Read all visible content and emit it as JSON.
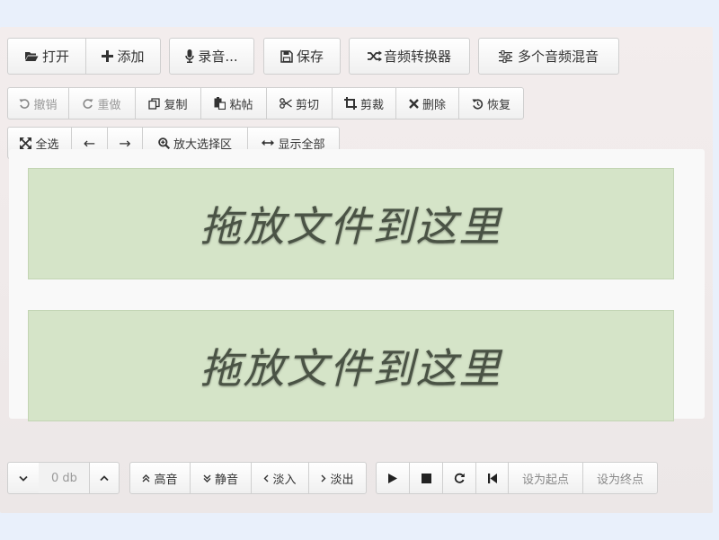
{
  "toolbar": {
    "open": "打开",
    "add": "添加",
    "record": "录音...",
    "save": "保存",
    "converter": "音频转换器",
    "mixer": "多个音频混音"
  },
  "edit": {
    "undo": "撤销",
    "redo": "重做",
    "copy": "复制",
    "paste": "粘帖",
    "cut": "剪切",
    "crop": "剪裁",
    "delete": "删除",
    "restore": "恢复"
  },
  "selection": {
    "select_all": "全选",
    "left_arrow": "←",
    "right_arrow": "→",
    "zoom_selection": "放大选择区",
    "show_all": "显示全部"
  },
  "tracks": [
    {
      "placeholder": "拖放文件到这里"
    },
    {
      "placeholder": "拖放文件到这里"
    }
  ],
  "bottom": {
    "volume_value": "0 db",
    "loud": "高音",
    "mute": "静音",
    "fade_in": "淡入",
    "fade_out": "淡出",
    "set_start": "设为起点",
    "set_end": "设为终点"
  }
}
